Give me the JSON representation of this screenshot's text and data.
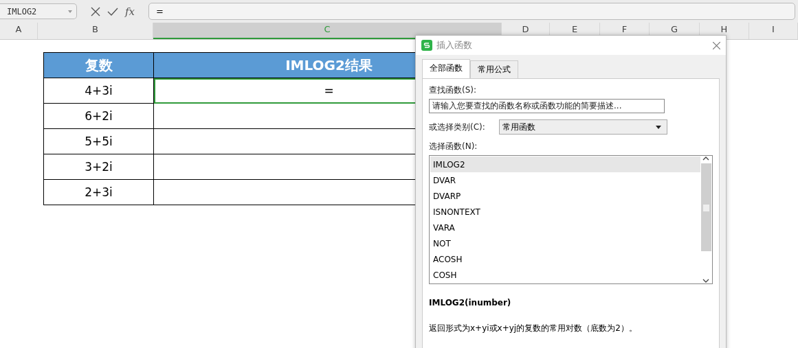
{
  "formula_bar": {
    "name_box": "IMLOG2",
    "fx_label": "fx",
    "formula": "="
  },
  "column_headers": [
    {
      "label": "A",
      "selected": false
    },
    {
      "label": "B",
      "selected": false
    },
    {
      "label": "C",
      "selected": true
    },
    {
      "label": "D",
      "selected": false
    },
    {
      "label": "E",
      "selected": false
    },
    {
      "label": "F",
      "selected": false
    },
    {
      "label": "G",
      "selected": false
    },
    {
      "label": "H",
      "selected": false
    },
    {
      "label": "I",
      "selected": false
    }
  ],
  "table": {
    "columns": [
      "复数",
      "IMLOG2结果"
    ],
    "rows": [
      {
        "cells": [
          "4+3i",
          "="
        ],
        "selected": true
      },
      {
        "cells": [
          "6+2i",
          ""
        ],
        "selected": false
      },
      {
        "cells": [
          "5+5i",
          ""
        ],
        "selected": false
      },
      {
        "cells": [
          "3+2i",
          ""
        ],
        "selected": false
      },
      {
        "cells": [
          "2+3i",
          ""
        ],
        "selected": false
      }
    ]
  },
  "dialog": {
    "title": "插入函数",
    "tabs": [
      {
        "label": "全部函数",
        "selected": true
      },
      {
        "label": "常用公式",
        "selected": false
      }
    ],
    "search_label": "查找函数(S):",
    "search_value": "请输入您要查找的函数名称或函数功能的简要描述...",
    "category_label": "或选择类别(C):",
    "category_value": "常用函数",
    "list_label": "选择函数(N):",
    "functions": [
      {
        "name": "IMLOG2",
        "selected": true
      },
      {
        "name": "DVAR",
        "selected": false
      },
      {
        "name": "DVARP",
        "selected": false
      },
      {
        "name": "ISNONTEXT",
        "selected": false
      },
      {
        "name": "VARA",
        "selected": false
      },
      {
        "name": "NOT",
        "selected": false
      },
      {
        "name": "ACOSH",
        "selected": false
      },
      {
        "name": "COSH",
        "selected": false
      }
    ],
    "syntax": "IMLOG2(inumber)",
    "description": "返回形式为x+yi或x+yj的复数的常用对数（底数为2）。"
  }
}
